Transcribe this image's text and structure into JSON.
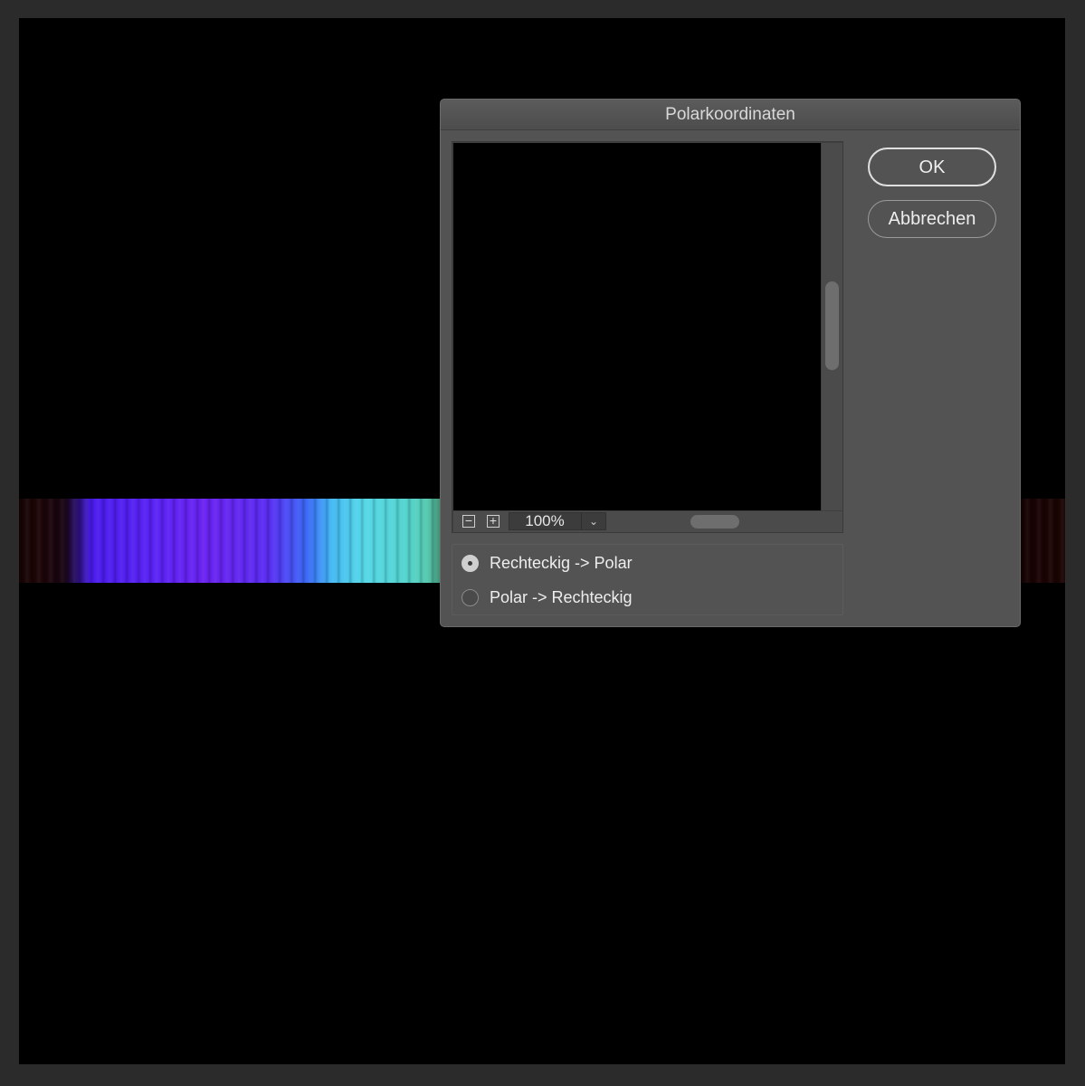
{
  "dialog": {
    "title": "Polarkoordinaten",
    "ok_label": "OK",
    "cancel_label": "Abbrechen",
    "zoom": {
      "out_icon": "−",
      "in_icon": "+",
      "value": "100%",
      "chevron": "⌄"
    },
    "options": [
      {
        "label": "Rechteckig -> Polar",
        "selected": true
      },
      {
        "label": "Polar -> Rechteckig",
        "selected": false
      }
    ]
  },
  "colors": {
    "dialog_bg": "#535353",
    "canvas_bg": "#000000",
    "frame_bg": "#2b2b2b"
  }
}
